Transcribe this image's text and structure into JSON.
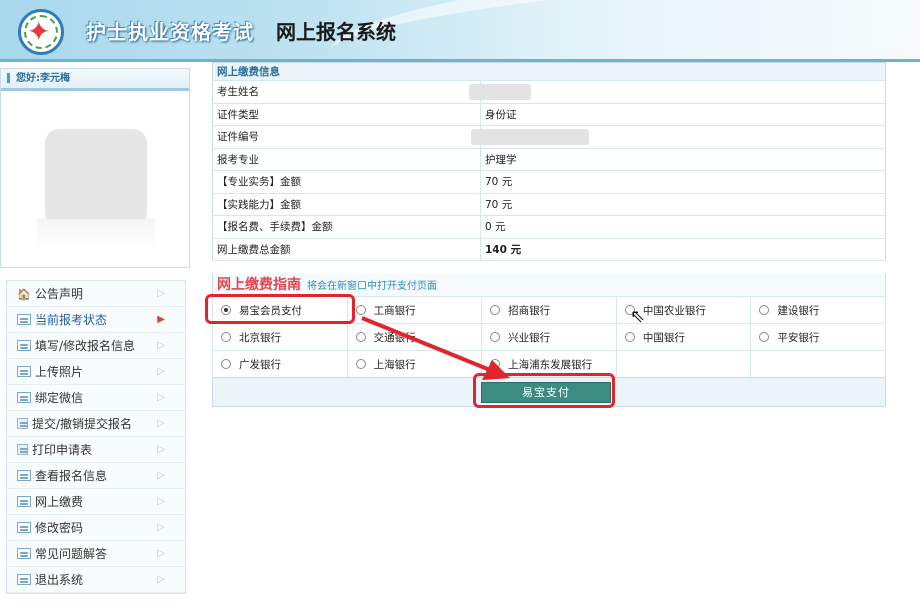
{
  "header": {
    "title": "护士执业资格考试",
    "subtitle": "网上报名系统",
    "logo_icon": "seal-logo-icon"
  },
  "user": {
    "greeting": "您好:李元梅"
  },
  "menu": {
    "items": [
      {
        "label": "公告声明",
        "icon": "house-icon"
      },
      {
        "label": "当前报考状态",
        "icon": "list-icon",
        "active": true
      },
      {
        "label": "填写/修改报名信息",
        "icon": "list-icon"
      },
      {
        "label": "上传照片",
        "icon": "list-icon"
      },
      {
        "label": "绑定微信",
        "icon": "list-icon"
      },
      {
        "label": "提交/撤销提交报名",
        "icon": "document-icon"
      },
      {
        "label": "打印申请表",
        "icon": "document-icon"
      },
      {
        "label": "查看报名信息",
        "icon": "list-icon"
      },
      {
        "label": "网上缴费",
        "icon": "list-icon"
      },
      {
        "label": "修改密码",
        "icon": "list-icon"
      },
      {
        "label": "常见问题解答",
        "icon": "list-icon"
      },
      {
        "label": "退出系统",
        "icon": "list-icon"
      }
    ]
  },
  "payment_info": {
    "section_title": "网上缴费信息",
    "rows": [
      {
        "label": "考生姓名",
        "value": ""
      },
      {
        "label": "证件类型",
        "value": "身份证"
      },
      {
        "label": "证件编号",
        "value": ""
      },
      {
        "label": "报考专业",
        "value": "护理学"
      },
      {
        "label": "【专业实务】金额",
        "value": "70 元"
      },
      {
        "label": "【实践能力】金额",
        "value": "70 元"
      },
      {
        "label": "【报名费、手续费】金额",
        "value": "0 元"
      },
      {
        "label": "网上缴费总金额",
        "value": "140 元"
      }
    ]
  },
  "guide": {
    "title": "网上缴费指南",
    "note": "将会在新窗口中打开支付页面"
  },
  "banks": {
    "selected": "易宝会员支付",
    "rows": [
      [
        "易宝会员支付",
        "工商银行",
        "招商银行",
        "中国农业银行",
        "建设银行"
      ],
      [
        "北京银行",
        "交通银行",
        "兴业银行",
        "中国银行",
        "平安银行"
      ],
      [
        "广发银行",
        "上海银行",
        "上海浦东发展银行",
        "",
        ""
      ]
    ]
  },
  "pay_button": {
    "label": "易宝支付"
  },
  "colors": {
    "annotation_red": "#e0262c",
    "pay_button_bg": "#3d8c82",
    "header_accent": "#6fb3d3"
  }
}
